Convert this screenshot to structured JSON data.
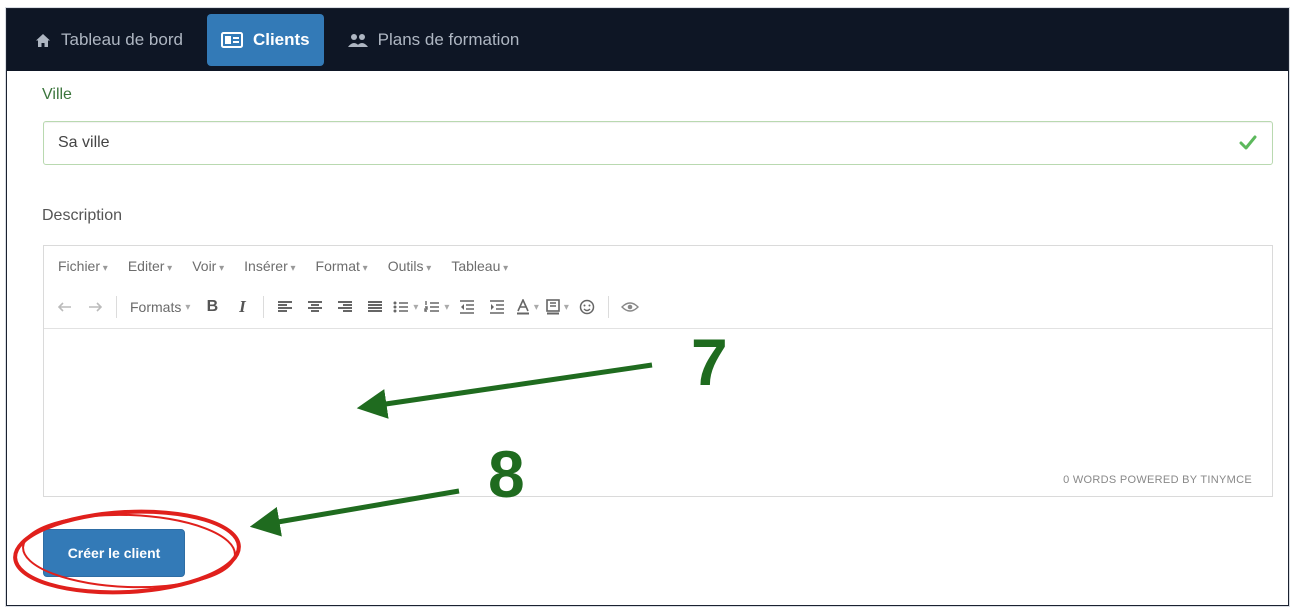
{
  "nav": {
    "items": [
      {
        "label": "Tableau de bord",
        "icon": "home-icon",
        "active": false
      },
      {
        "label": "Clients",
        "icon": "id-card-icon",
        "active": true
      },
      {
        "label": "Plans de formation",
        "icon": "users-icon",
        "active": false
      }
    ]
  },
  "form": {
    "city_label": "Ville",
    "city_value": "Sa ville",
    "description_label": "Description",
    "submit_label": "Créer le client"
  },
  "editor": {
    "menu": [
      "Fichier",
      "Editer",
      "Voir",
      "Insérer",
      "Format",
      "Outils",
      "Tableau"
    ],
    "formats_label": "Formats",
    "bold_label": "B",
    "italic_label": "I",
    "status": "0 WORDS POWERED BY TINYMCE"
  },
  "annotations": {
    "step7": "7",
    "step8": "8",
    "arrow_color": "#1f6b1f",
    "circle_color": "#e0201c"
  },
  "colors": {
    "nav_bg": "#0e1625",
    "accent": "#337ab7",
    "valid": "#3c763d"
  }
}
